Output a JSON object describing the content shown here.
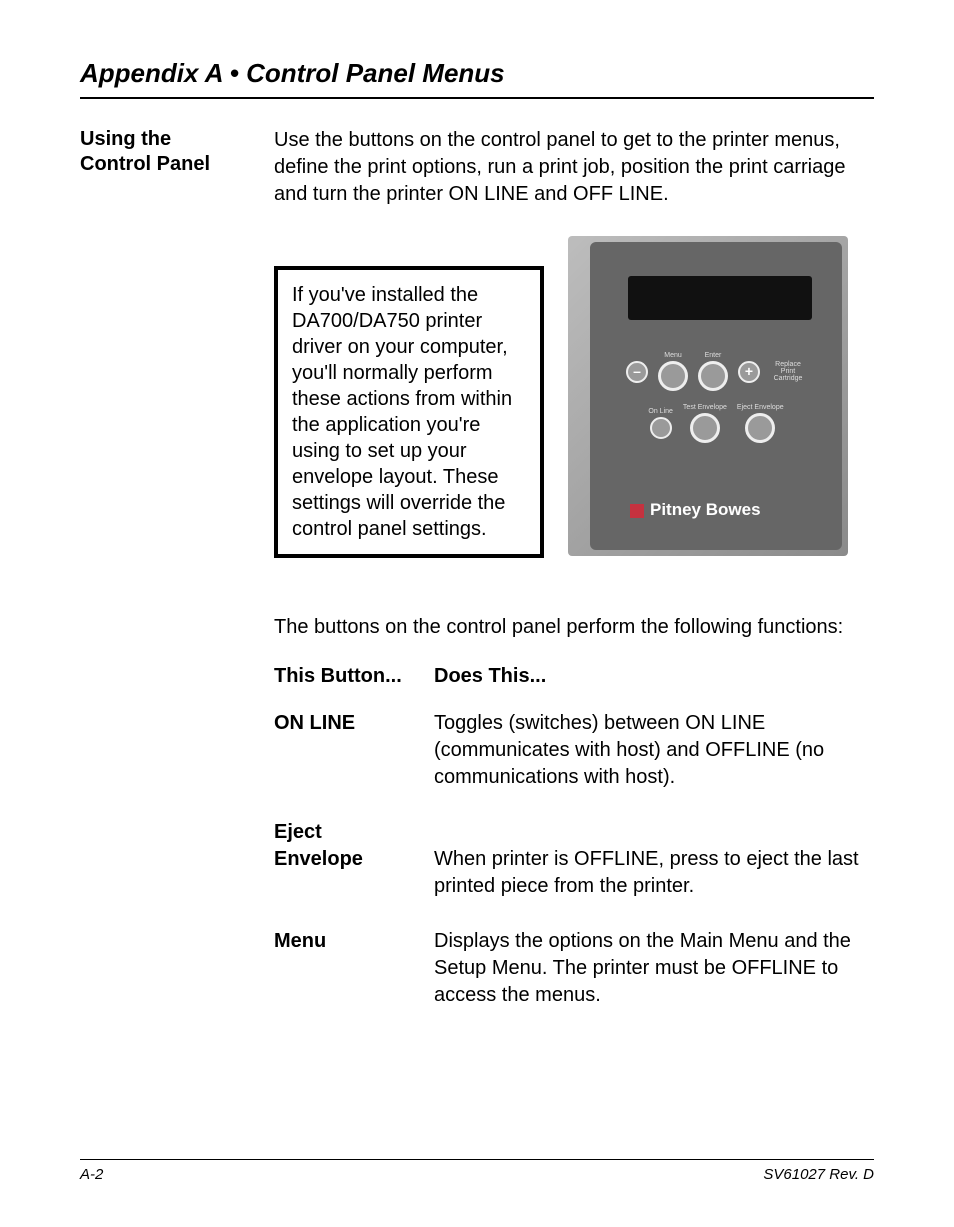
{
  "header": {
    "title": "Appendix A • Control Panel Menus"
  },
  "section": {
    "heading_line1": "Using the",
    "heading_line2": "Control Panel"
  },
  "intro": "Use the buttons on the control panel to get to the printer menus, define the print options, run a print job, position the print carriage and turn the printer ON LINE and OFF LINE.",
  "note": "If you've installed the DA700/DA750 printer driver on your computer, you'll normally perform these actions from within the application you're using to set up your envelope layout. These settings will override the control panel settings.",
  "panel": {
    "brand": "Pitney Bowes",
    "labels": {
      "menu": "Menu",
      "enter": "Enter",
      "online": "On Line",
      "test": "Test Envelope",
      "eject": "Eject Envelope",
      "replace": "Replace Print Cartridge"
    },
    "minus": "–",
    "plus": "+"
  },
  "preface": "The buttons on the control panel perform the following functions:",
  "table": {
    "head_button": "This Button...",
    "head_does": "Does This...",
    "rows": [
      {
        "btn": "ON LINE",
        "desc": "Toggles (switches) between ON LINE (communicates with host) and OFFLINE (no communications with host)."
      },
      {
        "btn": "Eject",
        "desc": ""
      },
      {
        "btn": "Envelope",
        "desc": "When printer is OFFLINE, press to eject the last printed piece from the printer."
      },
      {
        "btn": "Menu",
        "desc": "Displays the options on the Main Menu and the Setup Menu. The printer must be OFFLINE to access the menus."
      }
    ]
  },
  "footer": {
    "page": "A-2",
    "doc": "SV61027 Rev. D"
  }
}
